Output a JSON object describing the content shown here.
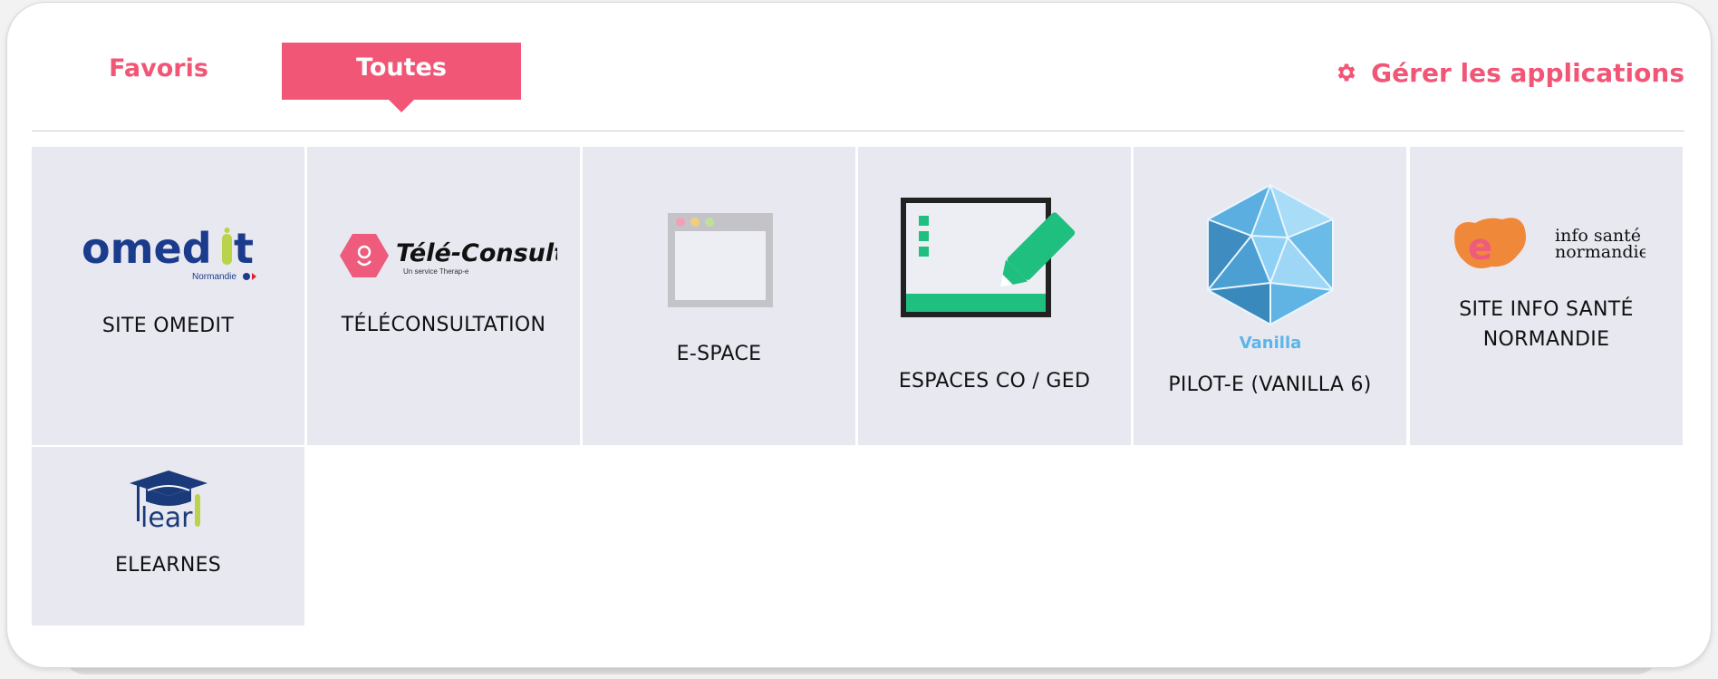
{
  "tabs": [
    {
      "label": "Favoris",
      "active": false
    },
    {
      "label": "Toutes",
      "active": true
    }
  ],
  "manage": {
    "label": "Gérer les applications",
    "icon": "gear-icon"
  },
  "colors": {
    "accent": "#f15676",
    "tile_bg": "#e8e8f1",
    "omedit_blue": "#1b3c8c",
    "espace_green": "#1fc07f",
    "vanilla_blue": "#5ab5e8"
  },
  "apps": [
    {
      "label": "SITE OMEDIT",
      "logo": {
        "wordmark_left": "omed",
        "wordmark_right": "t",
        "sub": "Normandie"
      }
    },
    {
      "label": "TÉLÉCONSULTATION",
      "logo": {
        "wordmark": "Télé-Consult",
        "sub": "Un service Therap-e"
      }
    },
    {
      "label": "E-SPACE",
      "logo": {}
    },
    {
      "label": "ESPACES CO / GED",
      "logo": {}
    },
    {
      "label": "PILOT-E (VANILLA 6)",
      "logo": {
        "wordmark": "Vanilla"
      }
    },
    {
      "label_line1": "SITE INFO SANTÉ",
      "label_line2": "NORMANDIE",
      "logo": {
        "line1": "info santé",
        "line2": "normandie"
      }
    },
    {
      "label": "ELEARNES",
      "logo": {
        "text": "lear"
      }
    }
  ]
}
